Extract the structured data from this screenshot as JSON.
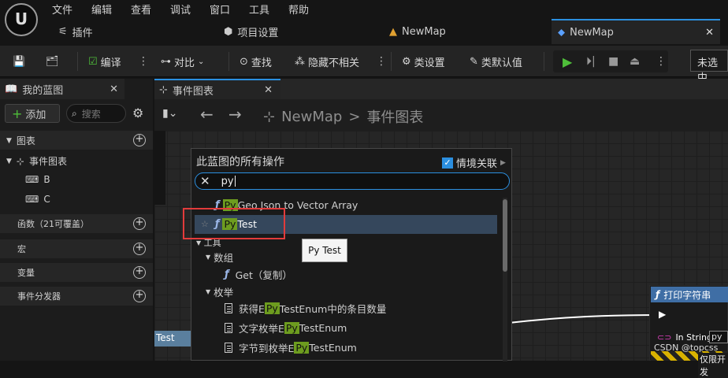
{
  "menu": [
    "文件",
    "编辑",
    "查看",
    "调试",
    "窗口",
    "工具",
    "帮助"
  ],
  "tabs": {
    "plugins": "插件",
    "project_settings": "项目设置",
    "map1": "NewMap",
    "map2": "NewMap"
  },
  "toolbar": {
    "compile": "编译",
    "diff": "对比",
    "find": "查找",
    "hide": "隐藏不相关",
    "class_settings": "类设置",
    "class_defaults": "类默认值",
    "unselected": "未选中"
  },
  "left": {
    "tab": "我的蓝图",
    "add": "添加",
    "search_placeholder": "搜索",
    "graphs": "图表",
    "event_graph": "事件图表",
    "vars": [
      "B",
      "C"
    ],
    "functions": "函数（21可覆盖）",
    "macros": "宏",
    "variables": "变量",
    "dispatchers": "事件分发器"
  },
  "graph": {
    "tab": "事件图表",
    "breadcrumb_root": "NewMap",
    "breadcrumb_sep": ">",
    "breadcrumb_leaf": "事件图表",
    "left_node_text": "Test",
    "print_node": "打印字符串",
    "in_string": "In String",
    "in_string_value": "py t",
    "bottom_text": "仅限开发"
  },
  "popup": {
    "title": "此蓝图的所有操作",
    "context": "情境关联",
    "search_value": "py",
    "tooltip": "Py Test",
    "items": {
      "geo_pre": "",
      "geo_hl": "Py",
      "geo_post": " Geo Json to Vector Array",
      "test_hl": "Py",
      "test_post": " Test",
      "tools": "工具",
      "array": "数组",
      "get": "Get（复制）",
      "enum": "枚举",
      "e1_pre": "获得E",
      "e1_hl": "Py",
      "e1_post": "TestEnum中的条目数量",
      "e2_pre": "文字枚举E",
      "e2_hl": "Py",
      "e2_post": "TestEnum",
      "e3_pre": "字节到枚举E",
      "e3_hl": "Py",
      "e3_post": "TestEnum"
    }
  },
  "watermark": "CSDN @topcss",
  "colors": {
    "accent": "#2b8fe0",
    "highlight": "#6d9c1f",
    "play": "#4fbf3a",
    "selection_box": "#e23b3b"
  }
}
